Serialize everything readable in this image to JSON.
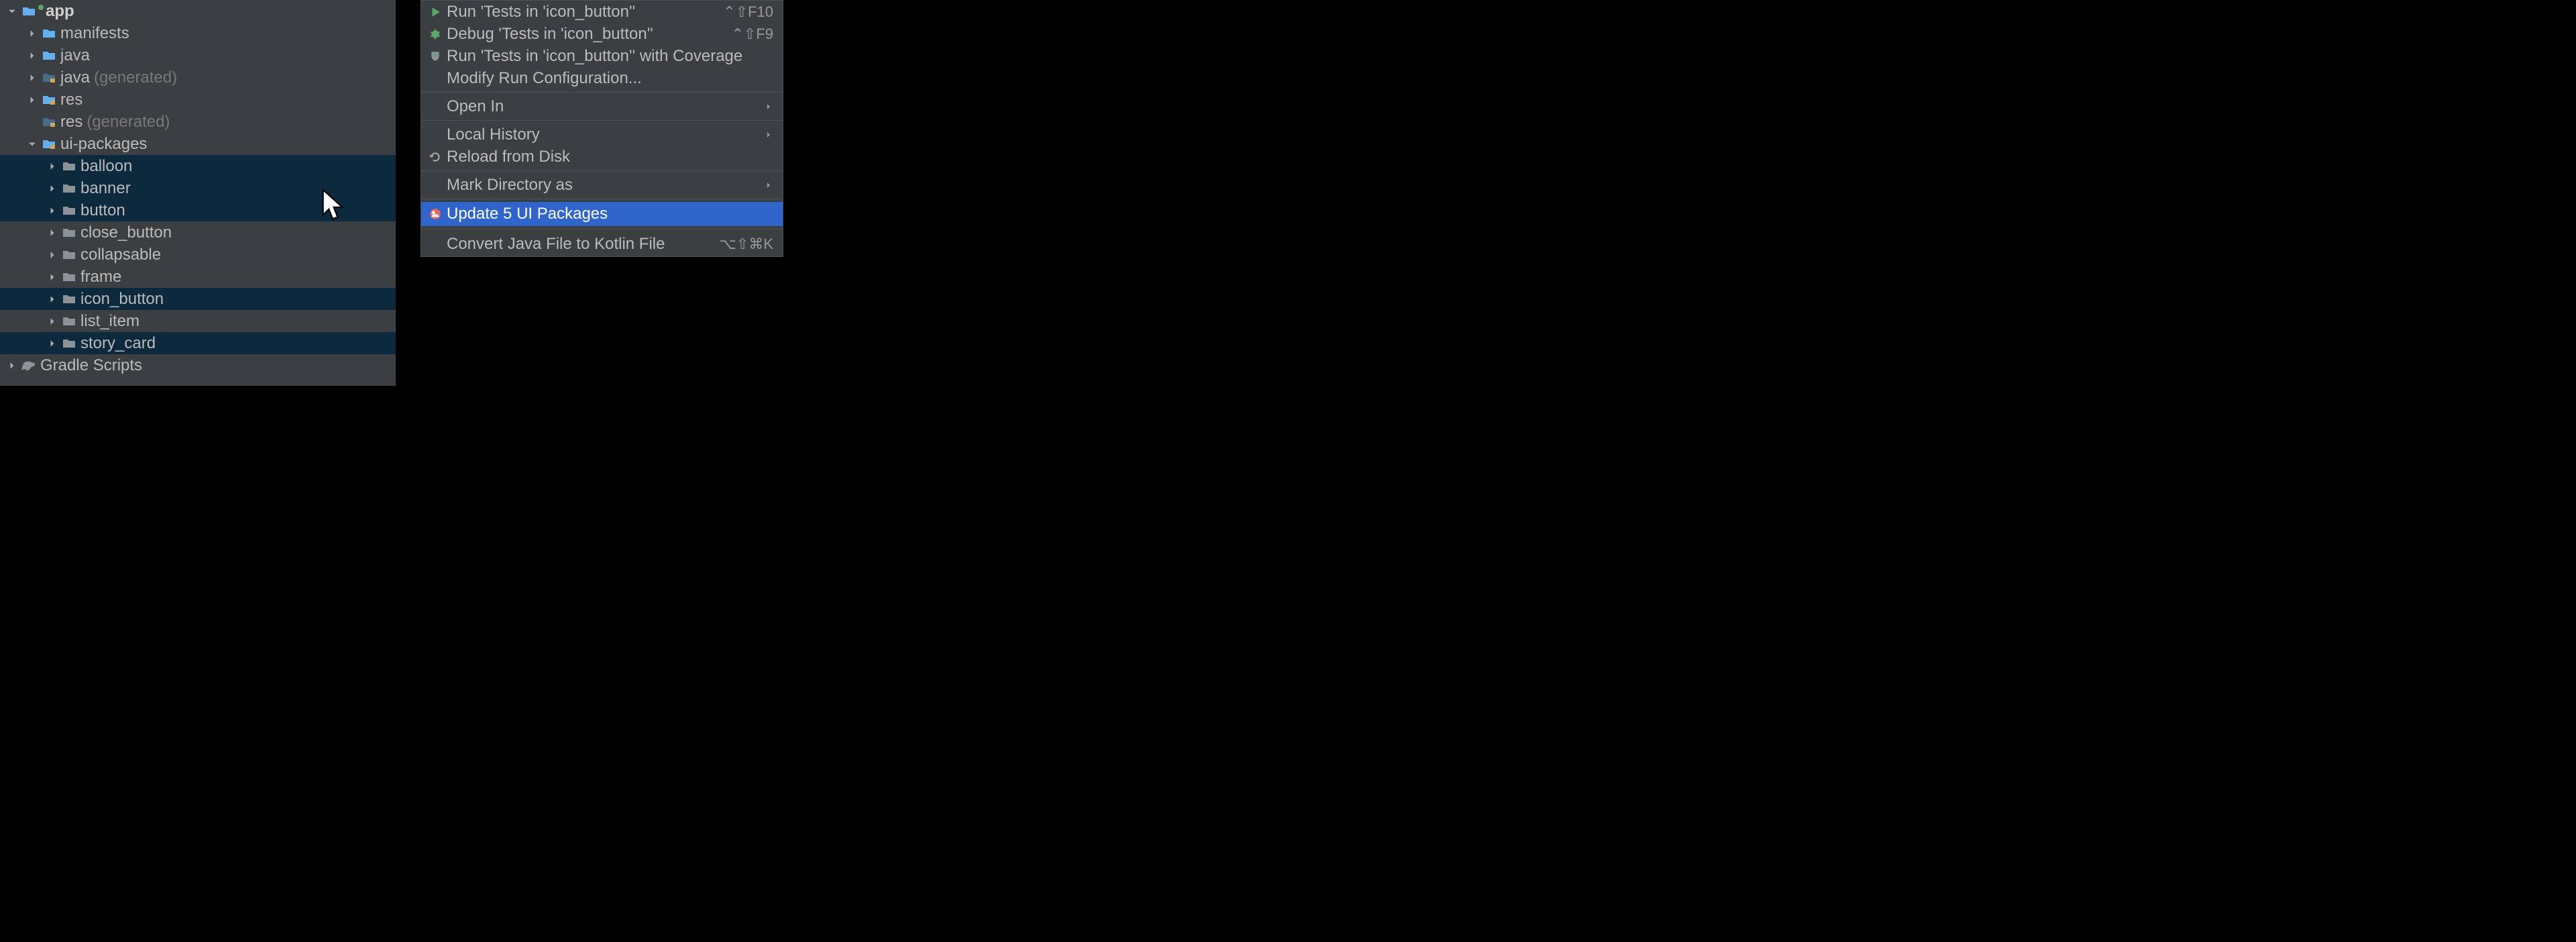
{
  "tree": {
    "app": {
      "label": "app"
    },
    "manifests": {
      "label": "manifests"
    },
    "java": {
      "label": "java"
    },
    "java_gen": {
      "label": "java",
      "suffix": "(generated)"
    },
    "res": {
      "label": "res"
    },
    "res_gen": {
      "label": "res",
      "suffix": "(generated)"
    },
    "ui_packages": {
      "label": "ui-packages"
    },
    "balloon": {
      "label": "balloon"
    },
    "banner": {
      "label": "banner"
    },
    "button": {
      "label": "button"
    },
    "close_button": {
      "label": "close_button"
    },
    "collapsable": {
      "label": "collapsable"
    },
    "frame": {
      "label": "frame"
    },
    "icon_button": {
      "label": "icon_button"
    },
    "list_item": {
      "label": "list_item"
    },
    "story_card": {
      "label": "story_card"
    },
    "gradle_scripts": {
      "label": "Gradle Scripts"
    }
  },
  "menu": {
    "run": {
      "label": "Run 'Tests in 'icon_button''",
      "shortcut": "⌃⇧F10"
    },
    "debug": {
      "label": "Debug 'Tests in 'icon_button''",
      "shortcut": "⌃⇧F9"
    },
    "coverage": {
      "label": "Run 'Tests in 'icon_button'' with Coverage"
    },
    "modify": {
      "label": "Modify Run Configuration..."
    },
    "open_in": {
      "label": "Open In"
    },
    "local_history": {
      "label": "Local History"
    },
    "reload": {
      "label": "Reload from Disk"
    },
    "mark_dir": {
      "label": "Mark Directory as"
    },
    "update_pkgs": {
      "label": "Update 5 UI Packages"
    },
    "convert": {
      "label": "Convert Java File to Kotlin File",
      "shortcut": "⌥⇧⌘K"
    }
  }
}
